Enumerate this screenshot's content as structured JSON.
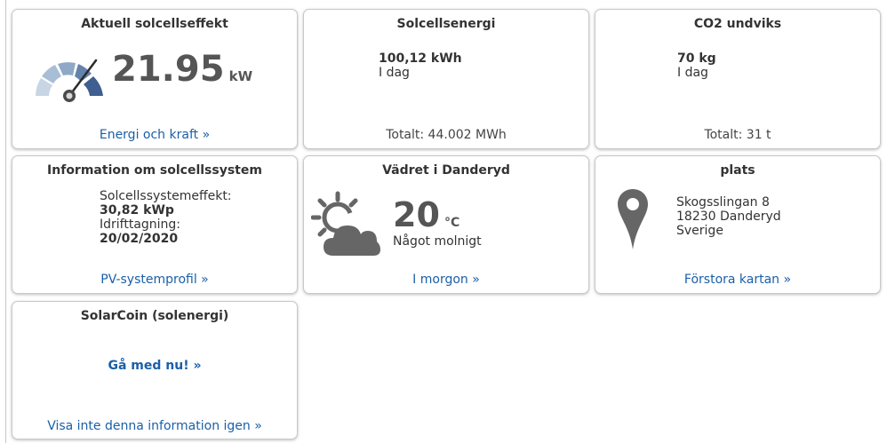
{
  "colors": {
    "link": "#1a5fa8",
    "gauge_light": "#c7d5e4",
    "gauge_mid": "#8fa8c8",
    "gauge_dark": "#3e5f8f",
    "icon_grey": "#666666"
  },
  "power": {
    "title": "Aktuell solcellseffekt",
    "value": "21.95",
    "unit": "kW",
    "icon": "gauge-icon",
    "link": "Energi och kraft »"
  },
  "energy": {
    "title": "Solcellsenergi",
    "value": "100,12 kWh",
    "label": "I dag",
    "total": "Totalt: 44.002 MWh"
  },
  "co2": {
    "title": "CO2 undviks",
    "value": "70 kg",
    "label": "I dag",
    "total": "Totalt: 31 t"
  },
  "system": {
    "title": "Information om solcellssystem",
    "capacity_label": "Solcellssystemeffekt:",
    "capacity_value": "30,82 kWp",
    "commissioning_label": "Idrifttagning:",
    "commissioning_value": "20/02/2020",
    "link": "PV-systemprofil »"
  },
  "weather": {
    "title": "Vädret i Danderyd",
    "temp": "20",
    "unit": "°C",
    "condition": "Något molnigt",
    "icon": "partly-cloudy-icon",
    "link": "I morgon »"
  },
  "location": {
    "title": "plats",
    "street": "Skogsslingan 8",
    "city": "18230 Danderyd",
    "country": "Sverige",
    "icon": "map-pin-icon",
    "link": "Förstora kartan »"
  },
  "solarcoin": {
    "title": "SolarCoin (solenergi)",
    "join": "Gå med nu! »",
    "dismiss": "Visa inte denna information igen »"
  }
}
